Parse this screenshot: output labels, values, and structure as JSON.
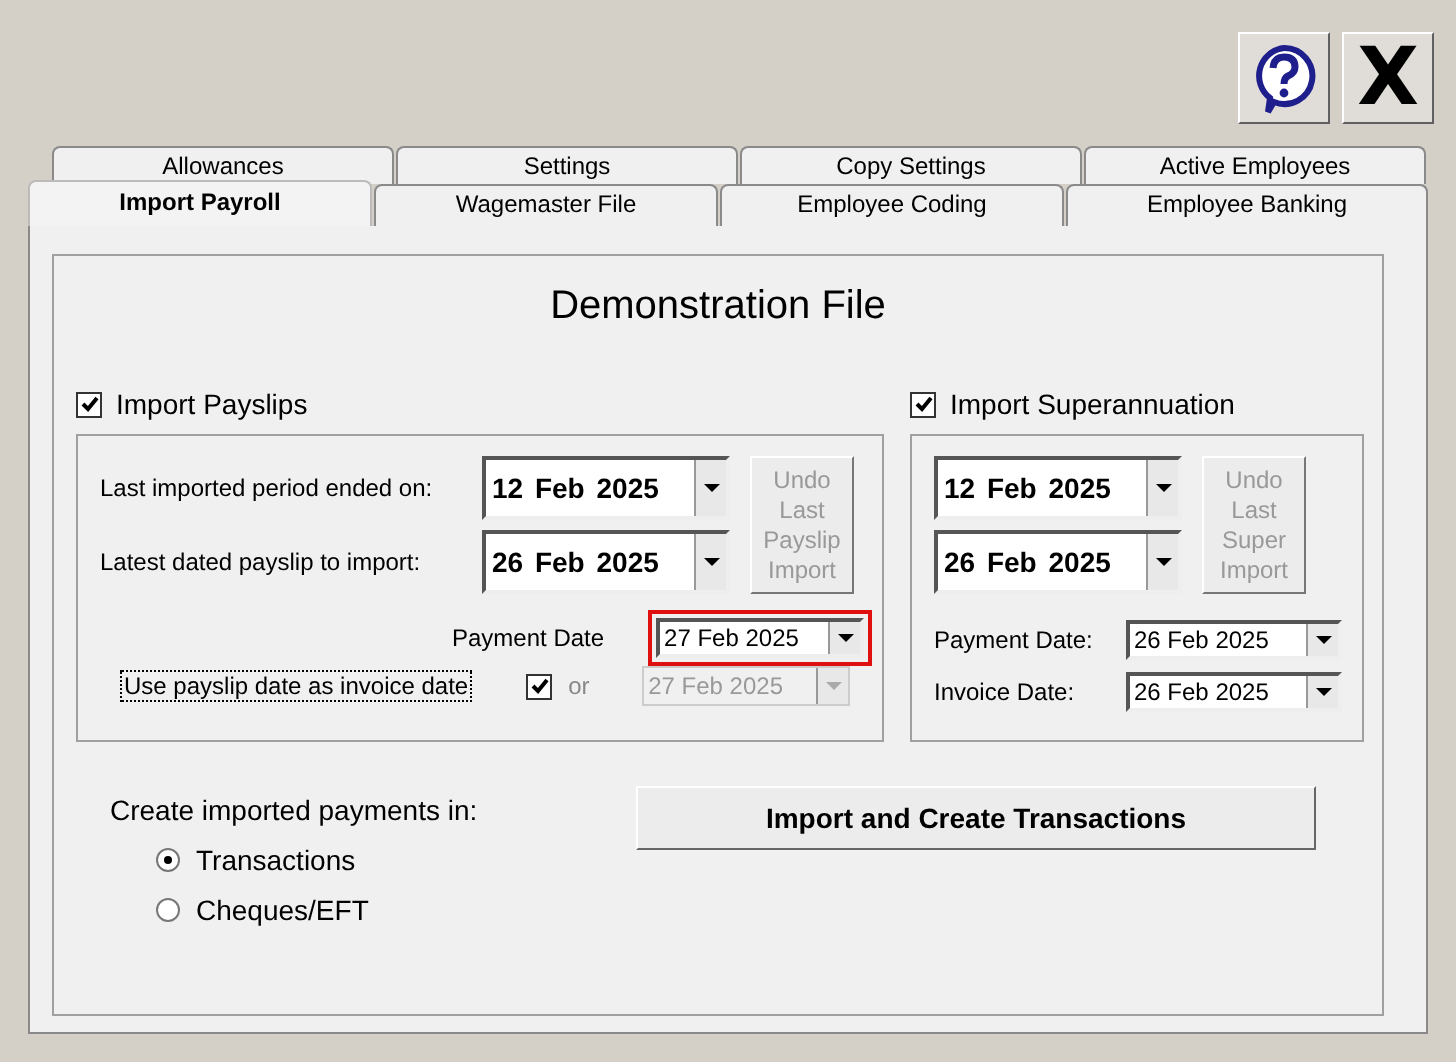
{
  "window": {
    "close_button": "X"
  },
  "tabs_back": [
    {
      "label": "Allowances",
      "selected": false
    },
    {
      "label": "Settings",
      "selected": false
    },
    {
      "label": "Copy Settings",
      "selected": false
    },
    {
      "label": "Active Employees",
      "selected": false
    }
  ],
  "tabs_front": [
    {
      "label": "Import Payroll",
      "selected": true
    },
    {
      "label": "Wagemaster File",
      "selected": false
    },
    {
      "label": "Employee Coding",
      "selected": false
    },
    {
      "label": "Employee Banking",
      "selected": false
    }
  ],
  "title": "Demonstration File",
  "payslips": {
    "label": "Import Payslips",
    "checked": true,
    "dates": [
      {
        "label": "Last imported period ended on:",
        "value": "12 Feb 2025"
      },
      {
        "label": "Latest dated payslip to import:",
        "value": "26 Feb 2025"
      }
    ],
    "undo_button": {
      "label": "Undo Last Payslip Import",
      "disabled": true
    },
    "payment_date": {
      "label": "Payment Date",
      "value": "27 Feb 2025",
      "highlighted": true
    },
    "invoice": {
      "label": "Use payslip date as invoice date",
      "checked": true,
      "or": "or",
      "value": "27 Feb 2025",
      "disabled": true
    }
  },
  "super": {
    "label": "Import Superannuation",
    "checked": true,
    "dates": [
      {
        "value": "12 Feb 2025"
      },
      {
        "value": "26 Feb 2025"
      }
    ],
    "undo_button": {
      "label": "Undo Last Super Import",
      "disabled": true
    },
    "small_dates": [
      {
        "label": "Payment Date:",
        "value": "26 Feb 2025"
      },
      {
        "label": "Invoice Date:",
        "value": "26 Feb 2025"
      }
    ]
  },
  "payments": {
    "label": "Create imported payments in:",
    "options": [
      {
        "label": "Transactions",
        "selected": true
      },
      {
        "label": "Cheques/EFT",
        "selected": false
      }
    ]
  },
  "import_button": "Import and Create Transactions"
}
